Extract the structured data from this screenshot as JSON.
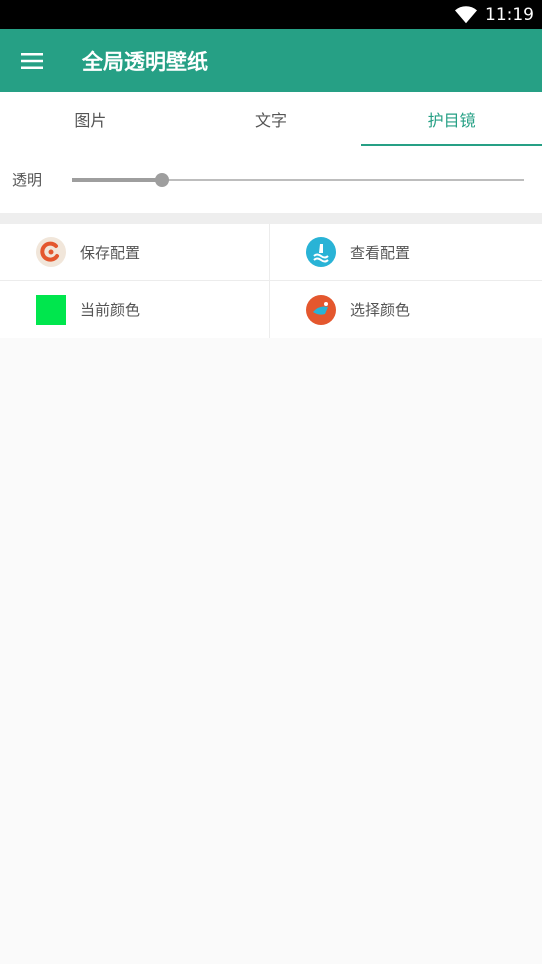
{
  "status": {
    "time": "11:19",
    "wifi_icon": "wifi-icon"
  },
  "appbar": {
    "title": "全局透明壁纸",
    "menu_icon": "menu-icon"
  },
  "tabs": [
    {
      "label": "图片",
      "active": false
    },
    {
      "label": "文字",
      "active": false
    },
    {
      "label": "护目镜",
      "active": true
    }
  ],
  "transparency": {
    "label": "透明",
    "value": 0.2
  },
  "actions": {
    "save_config": {
      "label": "保存配置",
      "icon": "save-icon"
    },
    "view_config": {
      "label": "查看配置",
      "icon": "view-icon"
    },
    "current_color": {
      "label": "当前颜色",
      "color": "#00e64d"
    },
    "choose_color": {
      "label": "选择颜色",
      "icon": "palette-icon"
    }
  },
  "colors": {
    "accent": "#26a085"
  }
}
